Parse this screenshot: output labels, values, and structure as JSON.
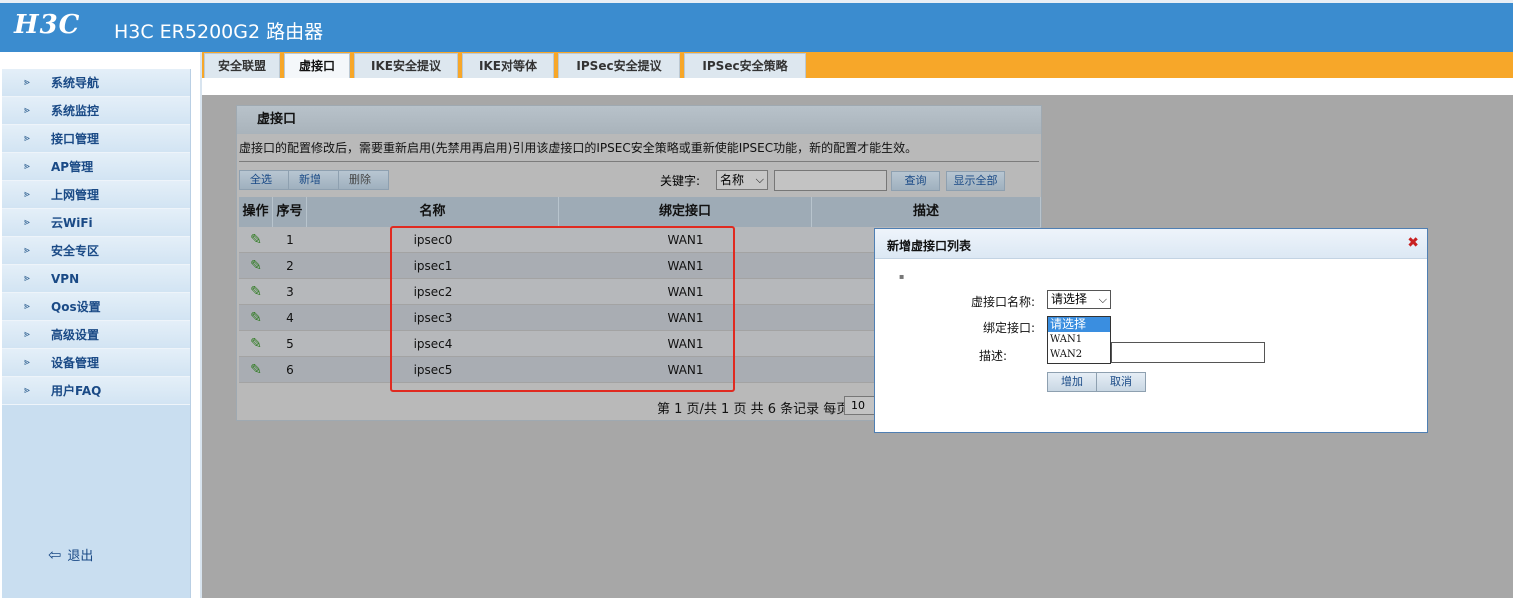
{
  "header": {
    "logo": "H3C",
    "title": "H3C ER5200G2 路由器"
  },
  "sidebar": {
    "items": [
      {
        "label": "系统导航"
      },
      {
        "label": "系统监控"
      },
      {
        "label": "接口管理"
      },
      {
        "label": "AP管理"
      },
      {
        "label": "上网管理"
      },
      {
        "label": "云WiFi"
      },
      {
        "label": "安全专区"
      },
      {
        "label": "VPN"
      },
      {
        "label": "Qos设置"
      },
      {
        "label": "高级设置"
      },
      {
        "label": "设备管理"
      },
      {
        "label": "用户FAQ"
      }
    ],
    "logout": "退出"
  },
  "tabs": [
    {
      "label": "安全联盟"
    },
    {
      "label": "虚接口"
    },
    {
      "label": "IKE安全提议"
    },
    {
      "label": "IKE对等体"
    },
    {
      "label": "IPSec安全提议"
    },
    {
      "label": "IPSec安全策略"
    }
  ],
  "panel": {
    "title": "虚接口",
    "notice": "虚接口的配置修改后，需要重新启用(先禁用再启用)引用该虚接口的IPSEC安全策略或重新使能IPSEC功能，新的配置才能生效。",
    "buttons": {
      "select_all": "全选",
      "add": "新增",
      "delete": "删除"
    },
    "keyword_label": "关键字:",
    "keyword_field": "名称",
    "query": "查询",
    "show_all": "显示全部",
    "columns": [
      "操作",
      "序号",
      "名称",
      "绑定接口",
      "描述"
    ],
    "rows": [
      {
        "no": "1",
        "name": "ipsec0",
        "iface": "WAN1"
      },
      {
        "no": "2",
        "name": "ipsec1",
        "iface": "WAN1"
      },
      {
        "no": "3",
        "name": "ipsec2",
        "iface": "WAN1"
      },
      {
        "no": "4",
        "name": "ipsec3",
        "iface": "WAN1"
      },
      {
        "no": "5",
        "name": "ipsec4",
        "iface": "WAN1"
      },
      {
        "no": "6",
        "name": "ipsec5",
        "iface": "WAN1"
      }
    ],
    "pager": "第 1 页/共 1 页 共 6 条记录 每页",
    "page_size": "10"
  },
  "dialog": {
    "title": "新增虚接口列表",
    "name_label": "虚接口名称:",
    "name_value": "请选择",
    "iface_label": "绑定接口:",
    "desc_label": "描述:",
    "options": [
      "请选择",
      "WAN1",
      "WAN2"
    ],
    "add": "增加",
    "cancel": "取消"
  },
  "colors": {
    "header": "#3b8ccf",
    "tabs_bar": "#f7a729",
    "highlight": "#e02a20"
  }
}
